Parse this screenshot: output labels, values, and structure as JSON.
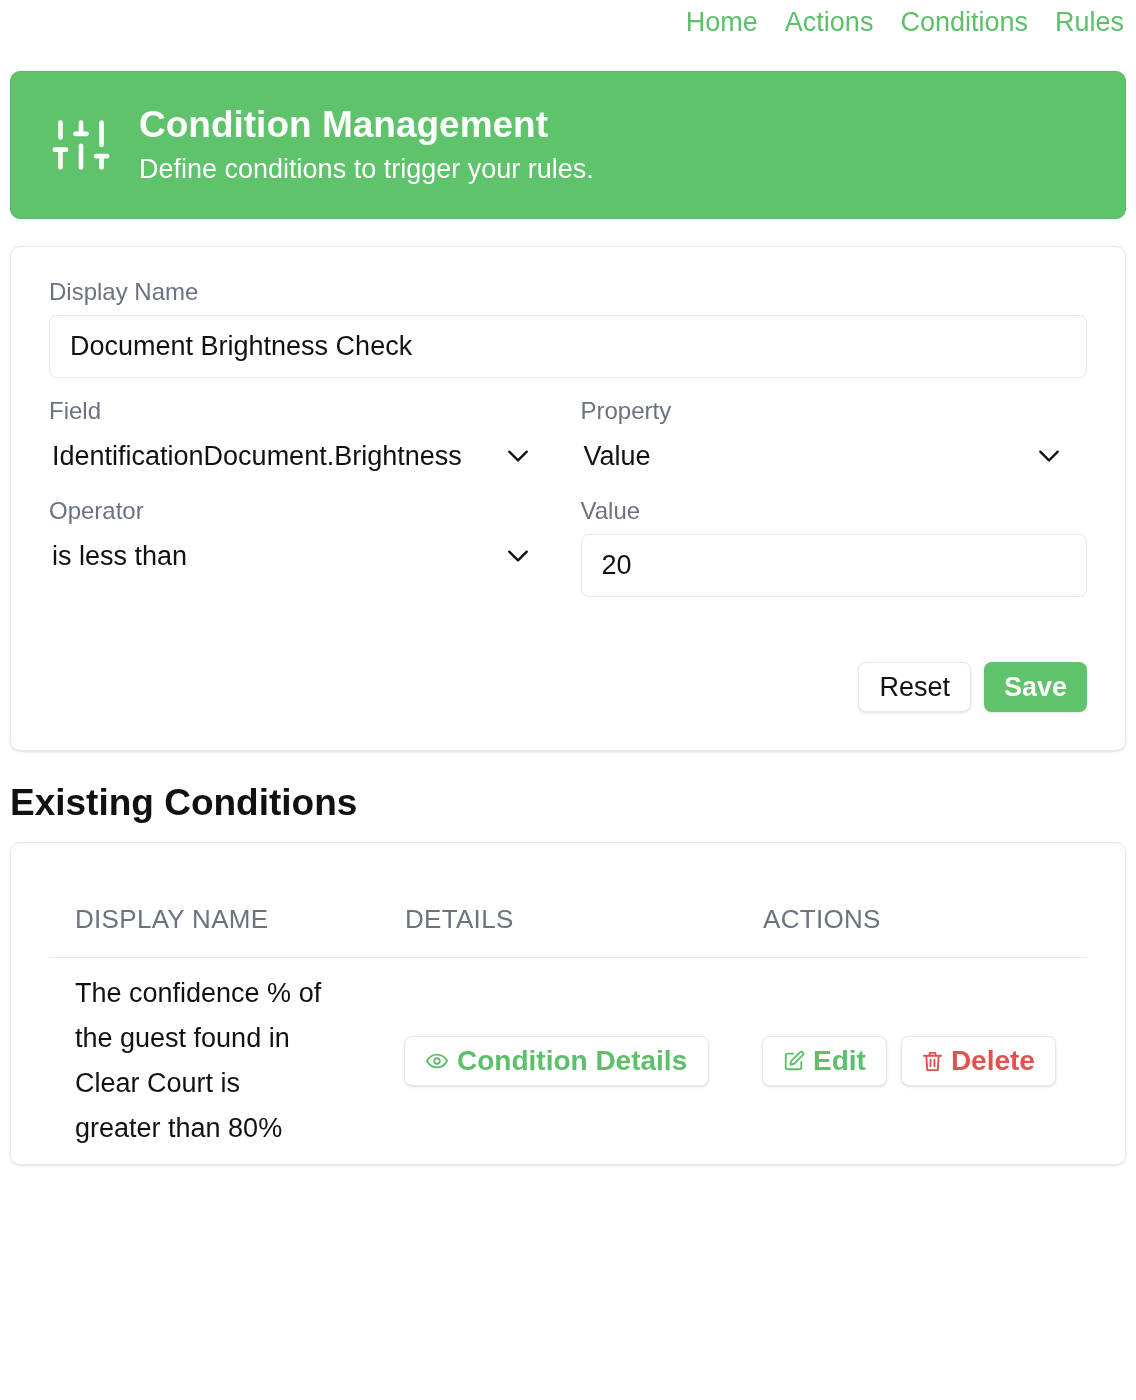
{
  "nav": [
    {
      "label": "Home"
    },
    {
      "label": "Actions"
    },
    {
      "label": "Conditions"
    },
    {
      "label": "Rules"
    }
  ],
  "header": {
    "title": "Condition Management",
    "subtitle": "Define conditions to trigger your rules."
  },
  "form": {
    "fields": [
      {
        "label": "Display Name",
        "kind": "input",
        "value": "Document Brightness Check"
      },
      {
        "label": "Field",
        "kind": "select",
        "value": "IdentificationDocument.Brightness"
      },
      {
        "label": "Property",
        "kind": "select",
        "value": "Value"
      },
      {
        "label": "Operator",
        "kind": "select",
        "value": "is less than"
      },
      {
        "label": "Value",
        "kind": "input",
        "value": "20"
      }
    ],
    "buttons": [
      {
        "label": "Reset",
        "kind": "secondary"
      },
      {
        "label": "Save",
        "kind": "primary"
      }
    ]
  },
  "conditions": {
    "title": "Existing Conditions",
    "columns": [
      "DISPLAY NAME",
      "DETAILS",
      "ACTIONS"
    ],
    "rows": [
      {
        "display_name": "The confidence % of the guest found in Clear Court is greater than 80%",
        "details_button": "Condition Details",
        "actions": [
          {
            "label": "Edit",
            "kind": "edit"
          },
          {
            "label": "Delete",
            "kind": "delete"
          }
        ]
      }
    ]
  }
}
